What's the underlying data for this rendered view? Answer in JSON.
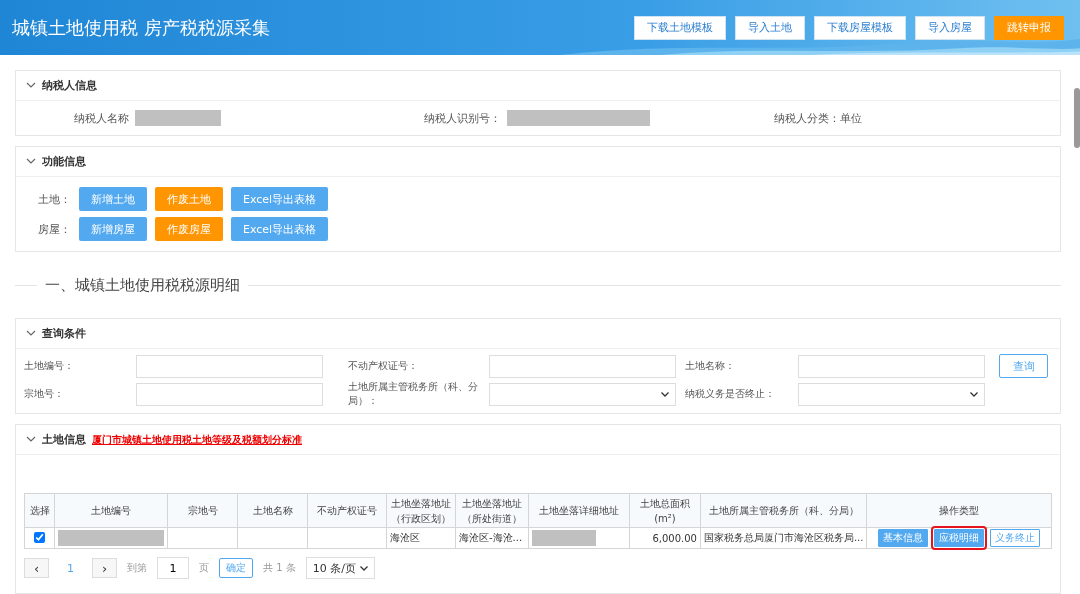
{
  "header": {
    "title": "城镇土地使用税 房产税税源采集",
    "buttons": [
      {
        "label": "下载土地模板",
        "kind": "outline"
      },
      {
        "label": "导入土地",
        "kind": "outline"
      },
      {
        "label": "下载房屋模板",
        "kind": "outline"
      },
      {
        "label": "导入房屋",
        "kind": "outline"
      },
      {
        "label": "跳转申报",
        "kind": "primary"
      }
    ]
  },
  "taxpayer": {
    "title": "纳税人信息",
    "expanded": true,
    "fields": [
      {
        "label": "纳税人名称",
        "redacted": true
      },
      {
        "label": "纳税人识别号：",
        "redacted": true
      },
      {
        "label": "纳税人分类：单位",
        "redacted": false
      }
    ]
  },
  "functions": {
    "title": "功能信息",
    "expanded": true,
    "rows": [
      {
        "label": "土地：",
        "buttons": [
          {
            "label": "新增土地",
            "kind": "blue"
          },
          {
            "label": "作废土地",
            "kind": "orange"
          },
          {
            "label": "Excel导出表格",
            "kind": "blue"
          }
        ]
      },
      {
        "label": "房屋：",
        "buttons": [
          {
            "label": "新增房屋",
            "kind": "blue"
          },
          {
            "label": "作废房屋",
            "kind": "orange"
          },
          {
            "label": "Excel导出表格",
            "kind": "blue"
          }
        ]
      }
    ]
  },
  "section_title": "一、城镇土地使用税税源明细",
  "query": {
    "title": "查询条件",
    "expanded": true,
    "fields": [
      {
        "label": "土地编号：",
        "kind": "text"
      },
      {
        "label": "不动产权证号：",
        "kind": "text"
      },
      {
        "label": "土地名称：",
        "kind": "text"
      },
      {
        "label": "宗地号：",
        "kind": "text"
      },
      {
        "label": "土地所属主管税务所（科、分局）：",
        "kind": "select"
      },
      {
        "label": "纳税义务是否终止：",
        "kind": "select"
      }
    ],
    "button": "查询"
  },
  "land": {
    "title": "土地信息",
    "link": "厦门市城镇土地使用税土地等级及税额划分标准",
    "expanded": true,
    "columns": [
      "选择",
      "土地编号",
      "宗地号",
      "土地名称",
      "不动产权证号",
      "土地坐落地址（行政区划）",
      "土地坐落地址（所处街道）",
      "土地坐落详细地址",
      "土地总面积(m²)",
      "土地所属主管税务所（科、分局）",
      "操作类型"
    ],
    "rows": [
      {
        "cells": [
          {
            "kind": "checkbox",
            "checked": true
          },
          {
            "kind": "text",
            "redacted": true
          },
          {
            "kind": "text",
            "text": ""
          },
          {
            "kind": "text",
            "text": ""
          },
          {
            "kind": "text",
            "text": ""
          },
          {
            "kind": "text",
            "text": "海沧区"
          },
          {
            "kind": "text",
            "text": "海沧区-海沧..."
          },
          {
            "kind": "text",
            "redacted": true
          },
          {
            "kind": "number",
            "text": "6,000.00"
          },
          {
            "kind": "text",
            "text": "国家税务总局厦门市海沧区税务局..."
          },
          {
            "kind": "actions",
            "actions": [
              {
                "label": "基本信息",
                "kind": "filled",
                "highlighted": false
              },
              {
                "label": "应税明细",
                "kind": "filled",
                "highlighted": true
              },
              {
                "label": "义务终止",
                "kind": "outline",
                "highlighted": false
              }
            ]
          }
        ]
      }
    ],
    "pagination": {
      "prev": "‹",
      "page": "1",
      "next": "›",
      "goto": "到第",
      "goto_value": "1",
      "page_unit": "页",
      "confirm": "确定",
      "total": "共 1 条",
      "page_size": "10 条/页"
    }
  }
}
